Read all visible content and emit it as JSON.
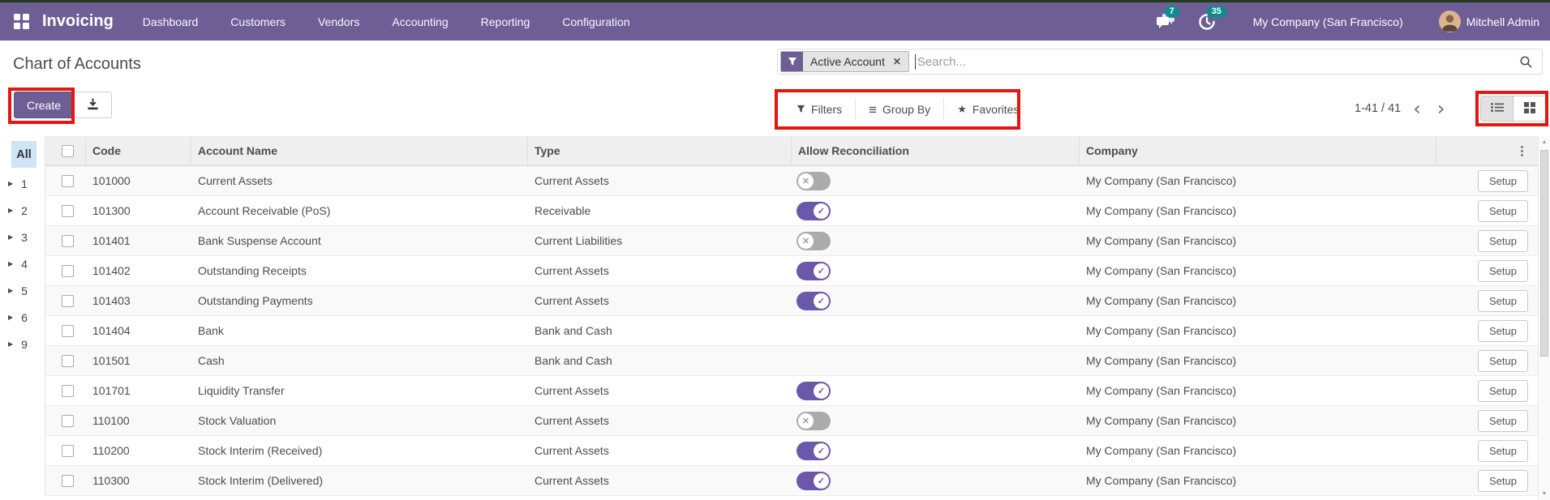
{
  "nav": {
    "app_name": "Invoicing",
    "menus": [
      "Dashboard",
      "Customers",
      "Vendors",
      "Accounting",
      "Reporting",
      "Configuration"
    ],
    "messages_badge": "7",
    "activities_badge": "35",
    "company_name": "My Company (San Francisco)",
    "user_name": "Mitchell Admin"
  },
  "control_panel": {
    "title": "Chart of Accounts",
    "create_label": "Create",
    "search_facet": "Active Account",
    "search_placeholder": "Search...",
    "facet_remove_glyph": "✕",
    "filters_label": "Filters",
    "group_by_label": "Group By",
    "favorites_label": "Favorites",
    "pager_text": "1-41 / 41",
    "pager_prev_glyph": "‹",
    "pager_next_glyph": "›"
  },
  "sidebar": {
    "all_label": "All",
    "groups": [
      "1",
      "2",
      "3",
      "4",
      "5",
      "6",
      "9"
    ]
  },
  "table": {
    "headers": {
      "code": "Code",
      "name": "Account Name",
      "type": "Type",
      "reconcile": "Allow Reconciliation",
      "company": "Company"
    },
    "setup_label": "Setup",
    "dots_glyph": "⋮",
    "rows": [
      {
        "code": "101000",
        "name": "Current Assets",
        "type": "Current Assets",
        "reconcile": "off",
        "company": "My Company (San Francisco)"
      },
      {
        "code": "101300",
        "name": "Account Receivable (PoS)",
        "type": "Receivable",
        "reconcile": "on",
        "company": "My Company (San Francisco)"
      },
      {
        "code": "101401",
        "name": "Bank Suspense Account",
        "type": "Current Liabilities",
        "reconcile": "off",
        "company": "My Company (San Francisco)"
      },
      {
        "code": "101402",
        "name": "Outstanding Receipts",
        "type": "Current Assets",
        "reconcile": "on",
        "company": "My Company (San Francisco)"
      },
      {
        "code": "101403",
        "name": "Outstanding Payments",
        "type": "Current Assets",
        "reconcile": "on",
        "company": "My Company (San Francisco)"
      },
      {
        "code": "101404",
        "name": "Bank",
        "type": "Bank and Cash",
        "reconcile": "none",
        "company": "My Company (San Francisco)"
      },
      {
        "code": "101501",
        "name": "Cash",
        "type": "Bank and Cash",
        "reconcile": "none",
        "company": "My Company (San Francisco)"
      },
      {
        "code": "101701",
        "name": "Liquidity Transfer",
        "type": "Current Assets",
        "reconcile": "on",
        "company": "My Company (San Francisco)"
      },
      {
        "code": "110100",
        "name": "Stock Valuation",
        "type": "Current Assets",
        "reconcile": "off",
        "company": "My Company (San Francisco)"
      },
      {
        "code": "110200",
        "name": "Stock Interim (Received)",
        "type": "Current Assets",
        "reconcile": "on",
        "company": "My Company (San Francisco)"
      },
      {
        "code": "110300",
        "name": "Stock Interim (Delivered)",
        "type": "Current Assets",
        "reconcile": "on",
        "company": "My Company (San Francisco)"
      }
    ],
    "toggle_on_glyph": "✓",
    "toggle_off_glyph": "✕"
  },
  "colors": {
    "navbar_purple": "#6d5e95",
    "toggle_on_purple": "#6b58ab",
    "toggle_off_gray": "#ababab",
    "badge_teal": "#0e8c8c",
    "annotation_red": "#e3170f",
    "sidebar_all_blue": "#cfe4f5"
  }
}
